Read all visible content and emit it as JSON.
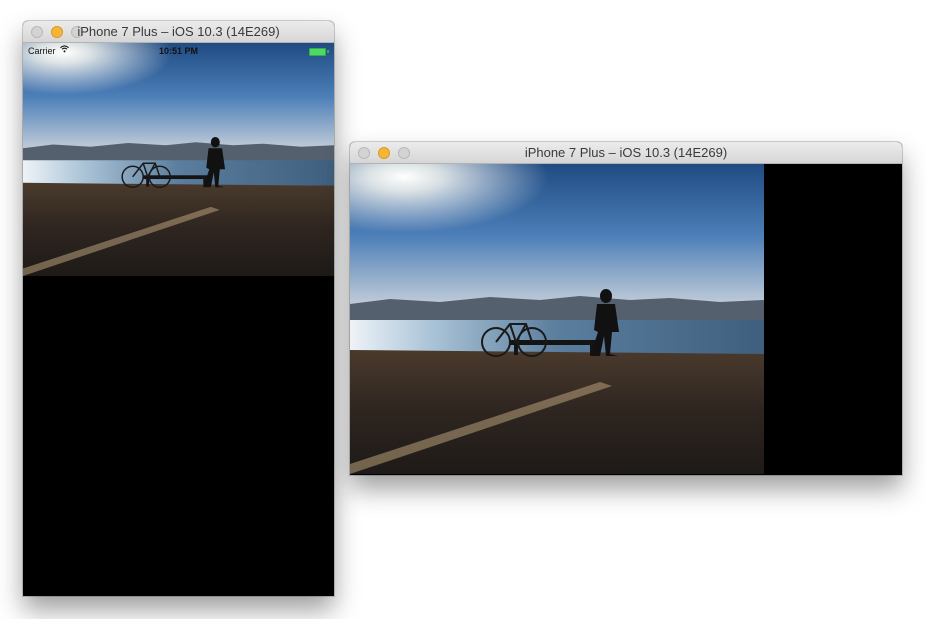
{
  "windows": [
    {
      "title": "iPhone 7 Plus – iOS 10.3 (14E269)",
      "orientation": "portrait",
      "status_bar": {
        "carrier": "Carrier",
        "time": "10:51 PM"
      }
    },
    {
      "title": "iPhone 7 Plus – iOS 10.3 (14E269)",
      "orientation": "landscape"
    }
  ],
  "icons": {
    "close": "close-light-icon",
    "minimize": "minimize-light-icon",
    "zoom": "zoom-light-icon",
    "wifi": "wifi-icon",
    "battery": "battery-icon"
  },
  "colors": {
    "titlebar_top": "#ececec",
    "titlebar_bottom": "#d6d6d6",
    "minimize_light": "#f6b536",
    "battery": "#4cd964",
    "screen_background": "#000000"
  }
}
